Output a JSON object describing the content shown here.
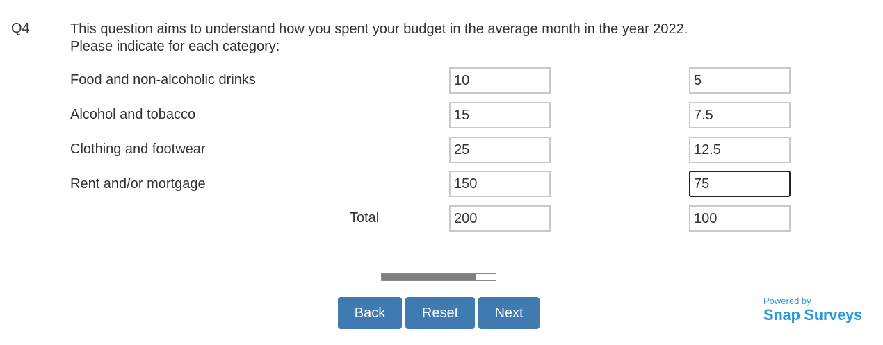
{
  "question": {
    "number": "Q4",
    "line1": "This question aims to understand how you spent your budget in the average month in the year 2022.",
    "line2": "Please indicate for each category:"
  },
  "rows": [
    {
      "label": "Food and non-alcoholic drinks",
      "col1": "10",
      "col2": "5"
    },
    {
      "label": "Alcohol and tobacco",
      "col1": "15",
      "col2": "7.5"
    },
    {
      "label": "Clothing and footwear",
      "col1": "25",
      "col2": "12.5"
    },
    {
      "label": "Rent and/or mortgage",
      "col1": "150",
      "col2": "75"
    }
  ],
  "total": {
    "label": "Total",
    "col1": "200",
    "col2": "100"
  },
  "progress": {
    "fraction": 0.83,
    "fill_color": "#808080"
  },
  "buttons": {
    "back": "Back",
    "reset": "Reset",
    "next": "Next"
  },
  "branding": {
    "powered_by": "Powered by",
    "name": "Snap Surveys",
    "color": "#2a9bd8"
  },
  "colors": {
    "button": "#3f7ab0",
    "button_text": "#ffffff"
  }
}
